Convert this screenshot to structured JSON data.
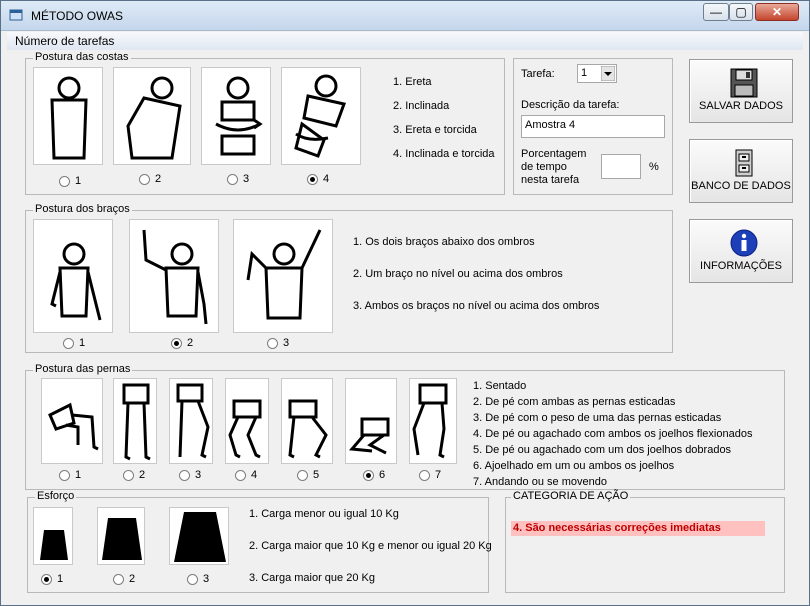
{
  "window": {
    "title": "MÉTODO OWAS",
    "minimize": "—",
    "maximize": "▢",
    "close": "✕"
  },
  "menu": {
    "item": "Número de tarefas"
  },
  "backs": {
    "title": "Postura das costas",
    "radios": [
      "1",
      "2",
      "3",
      "4"
    ],
    "selected": 4,
    "options": [
      "1. Ereta",
      "2. Inclinada",
      "3. Ereta e torcida",
      "4. Inclinada e torcida"
    ]
  },
  "task": {
    "label": "Tarefa:",
    "value": "1",
    "desc_label": "Descrição da tarefa:",
    "desc_value": "Amostra 4",
    "pct_label_1": "Porcentagem",
    "pct_label_2": "de tempo",
    "pct_label_3": "nesta tarefa",
    "pct_value": "",
    "pct_unit": "%"
  },
  "buttons": {
    "save": "SALVAR DADOS",
    "database": "BANCO DE DADOS",
    "info": "INFORMAÇÕES"
  },
  "arms": {
    "title": "Postura dos braços",
    "radios": [
      "1",
      "2",
      "3"
    ],
    "selected": 2,
    "options": [
      "1. Os dois braços abaixo dos ombros",
      "2. Um braço no nível ou acima dos ombros",
      "3. Ambos os braços no nível ou acima dos ombros"
    ]
  },
  "legs": {
    "title": "Postura das pernas",
    "radios": [
      "1",
      "2",
      "3",
      "4",
      "5",
      "6",
      "7"
    ],
    "selected": 6,
    "options": [
      "1. Sentado",
      "2. De pé com ambas as pernas esticadas",
      "3. De pé com o peso de uma das pernas esticadas",
      "4. De pé ou agachado com ambos os joelhos flexionados",
      "5. De pé ou agachado com um dos joelhos dobrados",
      "6. Ajoelhado em um ou ambos os joelhos",
      "7. Andando ou se movendo"
    ]
  },
  "effort": {
    "title": "Esforço",
    "radios": [
      "1",
      "2",
      "3"
    ],
    "selected": 1,
    "options": [
      "1. Carga menor ou igual 10 Kg",
      "2. Carga maior que 10 Kg e menor ou igual 20 Kg",
      "3. Carga maior que 20 Kg"
    ]
  },
  "action": {
    "title": "CATEGORIA DE AÇÃO",
    "result": "4. São necessárias correções imediatas",
    "result_color": "#c00000"
  }
}
